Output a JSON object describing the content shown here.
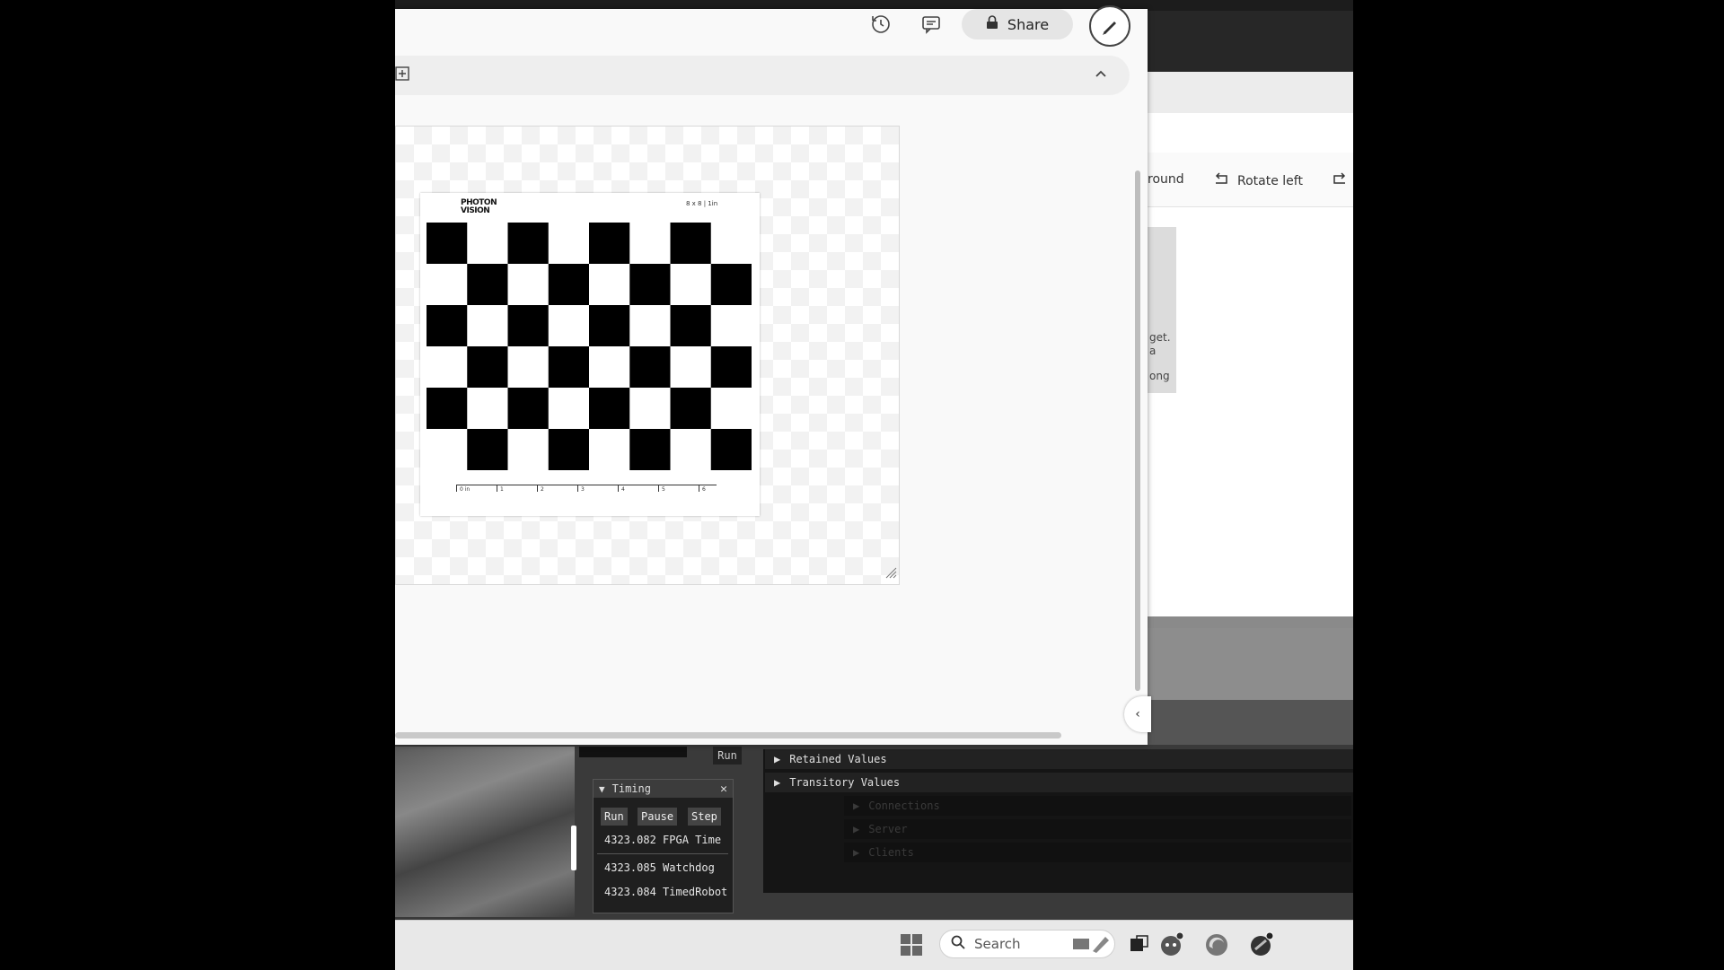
{
  "editor": {
    "share_label": "Share",
    "history_icon": "history-icon",
    "comments_icon": "comments-icon",
    "pen_icon": "pen-icon"
  },
  "image": {
    "logo_text_line1": "PHOTON",
    "logo_text_line2": "VISION",
    "size_text": "8 x 8 | 1in",
    "ruler_labels": [
      "0 in",
      "1",
      "2",
      "3",
      "4",
      "5",
      "6"
    ]
  },
  "photos": {
    "toolbar": {
      "background_label": "round",
      "rotate_left_label": "Rotate left"
    },
    "thumb_lines": [
      "get.",
      "a",
      "ong"
    ]
  },
  "sim": {
    "run_label": "Run",
    "timing": {
      "title": "Timing",
      "buttons": {
        "run": "Run",
        "pause": "Pause",
        "step": "Step"
      },
      "rows": [
        {
          "value": "4323.082",
          "name": "FPGA Time"
        },
        {
          "value": "4323.085",
          "name": "Watchdog"
        },
        {
          "value": "4323.084",
          "name": "TimedRobot"
        }
      ]
    },
    "networktables": {
      "retained": "Retained Values",
      "transitory": "Transitory Values",
      "ghost_rows": [
        "Connections",
        "Server",
        "Clients"
      ]
    }
  },
  "taskbar": {
    "search_placeholder": "Search"
  }
}
